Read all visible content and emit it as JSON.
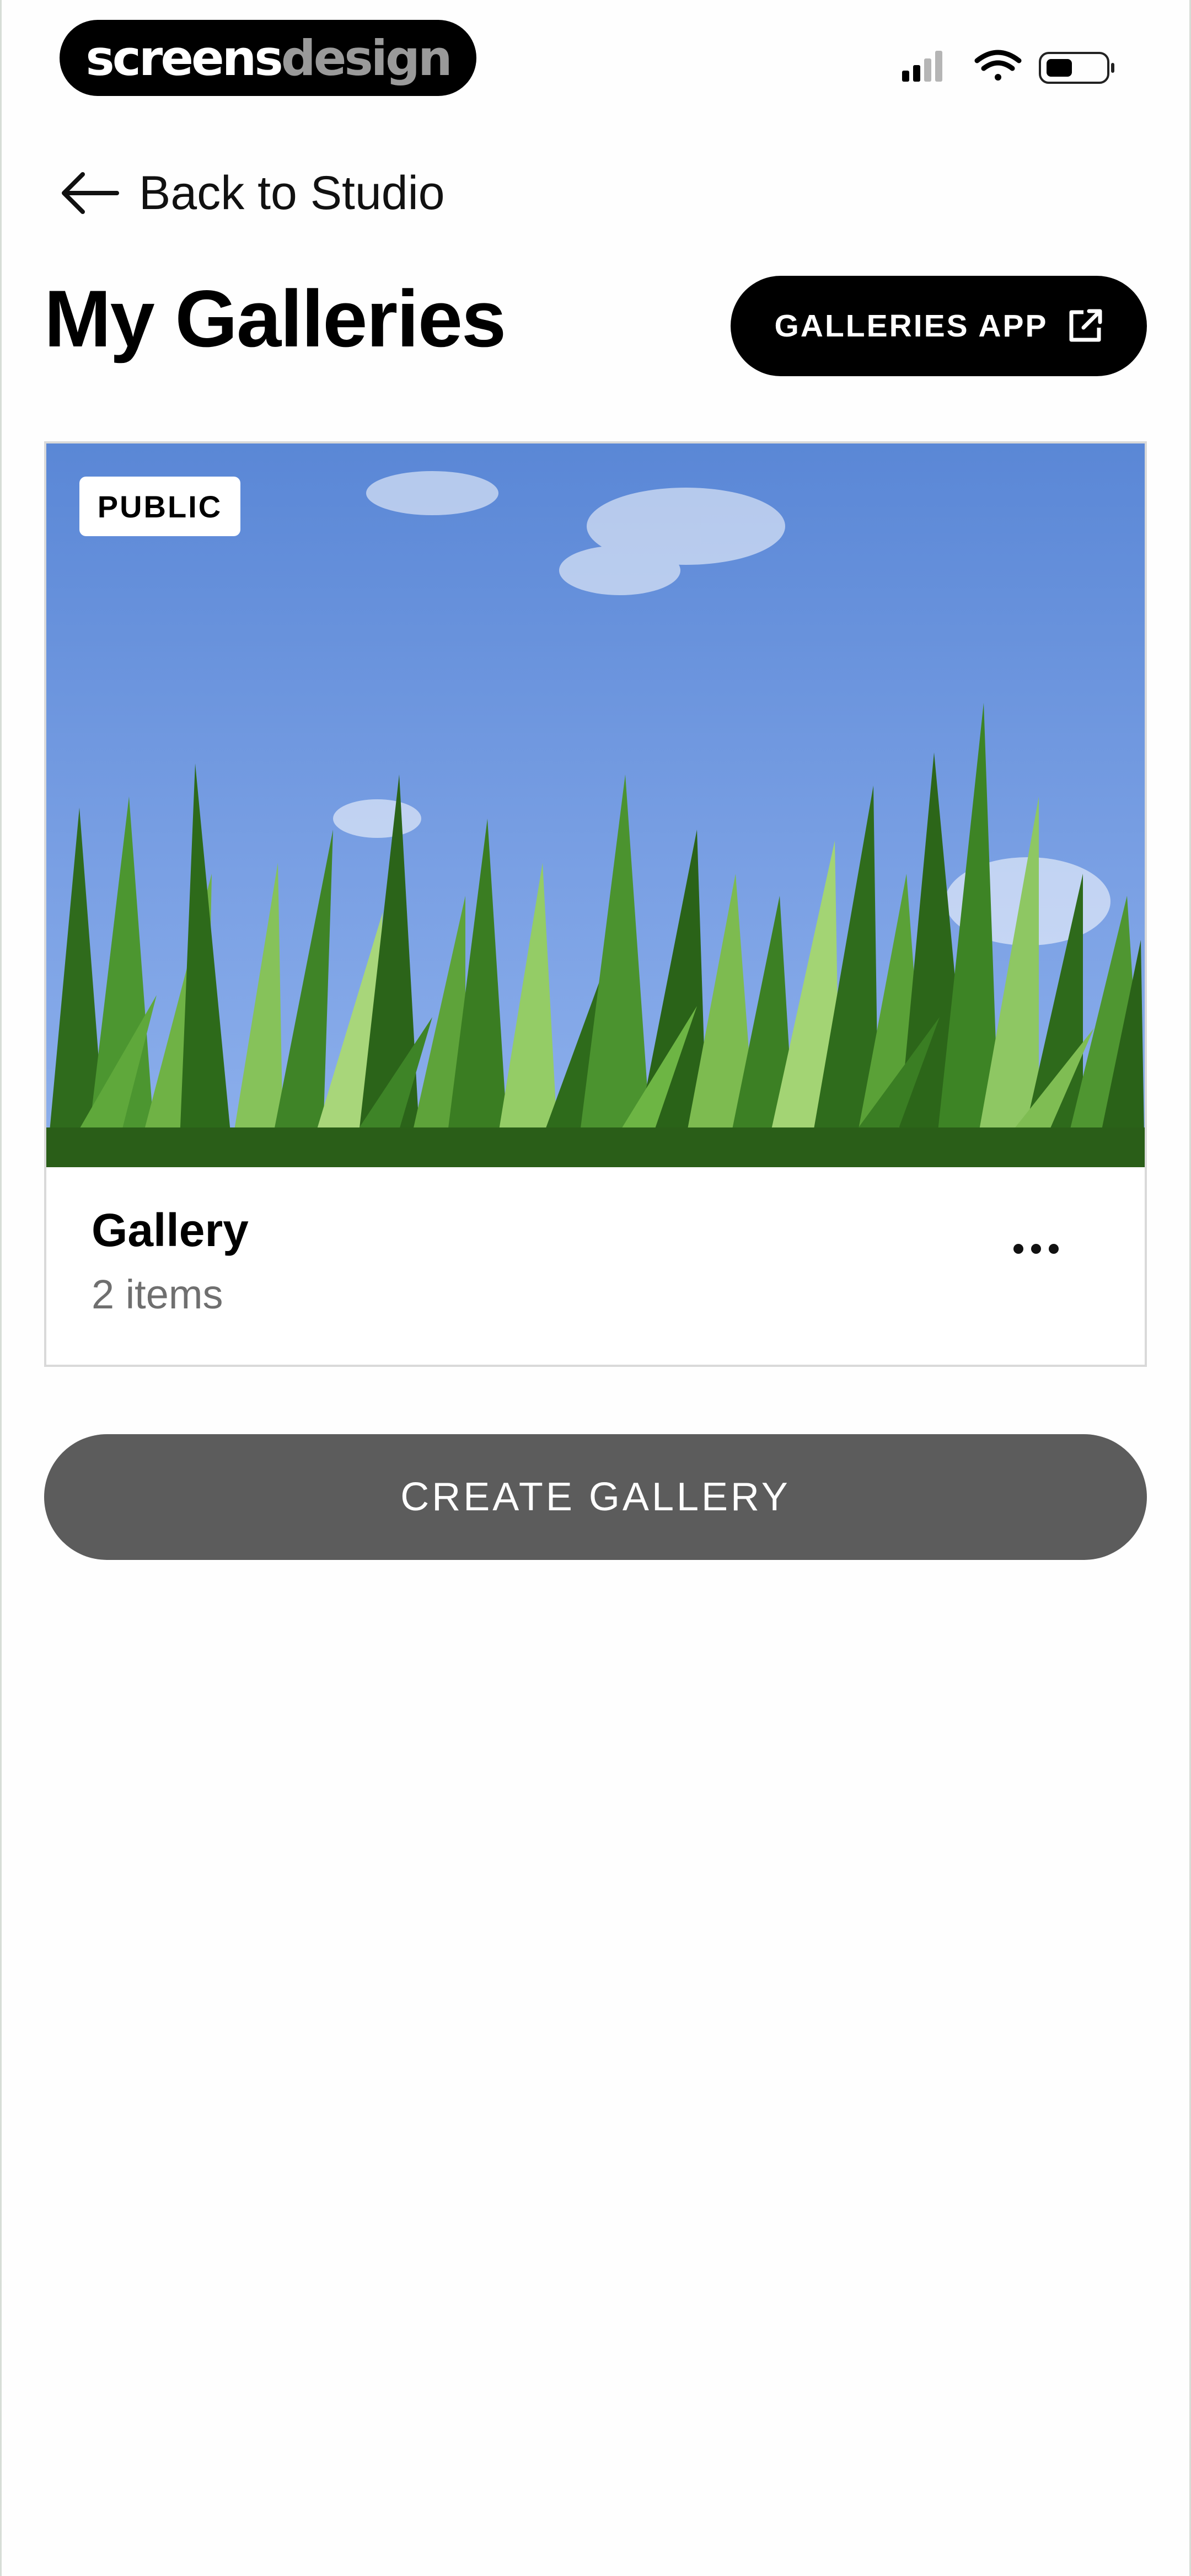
{
  "status_bar": {
    "brand_part1": "screens",
    "brand_part2": "design",
    "icons": [
      "cellular-signal-icon",
      "wifi-icon",
      "battery-icon"
    ]
  },
  "nav": {
    "back_label": "Back to Studio",
    "back_icon": "arrow-left-icon"
  },
  "header": {
    "title": "My Galleries",
    "apps_button_label": "GALLERIES APP",
    "apps_button_icon": "external-link-icon"
  },
  "galleries": [
    {
      "visibility": "PUBLIC",
      "name": "Gallery",
      "count": "2 items",
      "menu_icon": "more-horizontal-icon"
    }
  ],
  "actions": {
    "create_label": "CREATE GALLERY"
  },
  "colors": {
    "primary_button": "#000000",
    "create_button": "#5c5c5c",
    "secondary_text": "#6f6f6f",
    "card_border": "#d9d9d9",
    "sky": "#6f95dc",
    "grass": "#4f8f2a"
  }
}
